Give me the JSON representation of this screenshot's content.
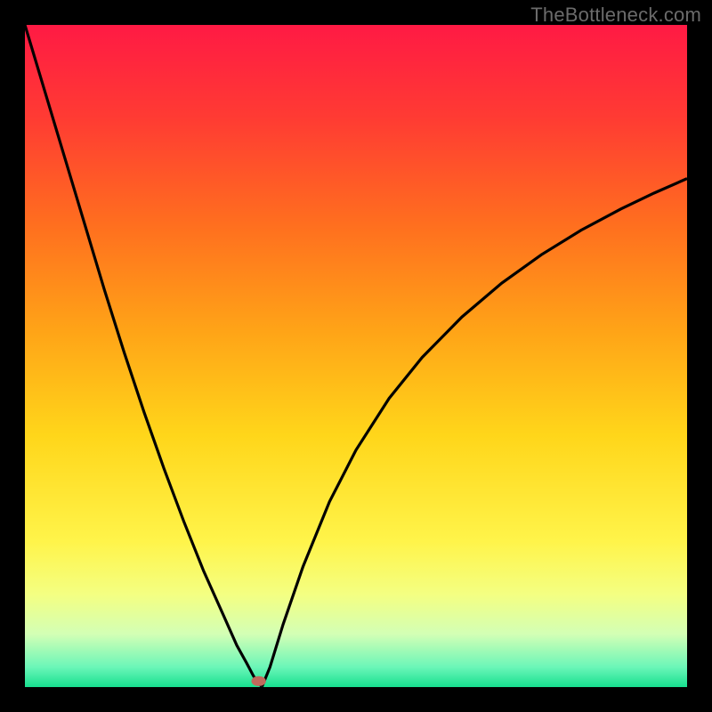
{
  "watermark": "TheBottleneck.com",
  "chart_data": {
    "type": "line",
    "title": "",
    "xlabel": "",
    "ylabel": "",
    "xlim": [
      0,
      100
    ],
    "ylim": [
      0,
      100
    ],
    "gradient_stops": [
      {
        "offset": 0.0,
        "color": "#ff1a44"
      },
      {
        "offset": 0.14,
        "color": "#ff3b33"
      },
      {
        "offset": 0.3,
        "color": "#ff6e1f"
      },
      {
        "offset": 0.46,
        "color": "#ffa317"
      },
      {
        "offset": 0.62,
        "color": "#ffd61a"
      },
      {
        "offset": 0.78,
        "color": "#fff44a"
      },
      {
        "offset": 0.86,
        "color": "#f4ff82"
      },
      {
        "offset": 0.92,
        "color": "#d3ffb5"
      },
      {
        "offset": 0.97,
        "color": "#6bf6b8"
      },
      {
        "offset": 1.0,
        "color": "#17e08f"
      }
    ],
    "series": [
      {
        "name": "left-branch",
        "x": [
          0.0,
          3.0,
          6.0,
          9.0,
          12.0,
          15.0,
          18.0,
          21.0,
          24.0,
          27.0,
          30.0,
          32.0,
          33.5,
          34.5,
          35.3,
          35.8
        ],
        "y": [
          100.0,
          90.0,
          80.0,
          70.0,
          60.0,
          50.5,
          41.5,
          33.0,
          25.0,
          17.5,
          10.8,
          6.3,
          3.6,
          1.7,
          0.55,
          0.05
        ]
      },
      {
        "name": "right-branch",
        "x": [
          35.8,
          37.0,
          39.0,
          42.0,
          46.0,
          50.0,
          55.0,
          60.0,
          66.0,
          72.0,
          78.0,
          84.0,
          90.0,
          95.0,
          100.0
        ],
        "y": [
          0.05,
          3.0,
          9.5,
          18.2,
          28.0,
          35.8,
          43.6,
          49.8,
          55.9,
          61.0,
          65.3,
          69.0,
          72.2,
          74.6,
          76.8
        ]
      }
    ],
    "marker": {
      "name": "minimum-marker",
      "x": 35.3,
      "y": 0.9,
      "rx": 1.1,
      "ry": 0.75,
      "fill": "#c06a5c"
    },
    "line_style": {
      "stroke": "#000000",
      "width": 3.2
    }
  }
}
